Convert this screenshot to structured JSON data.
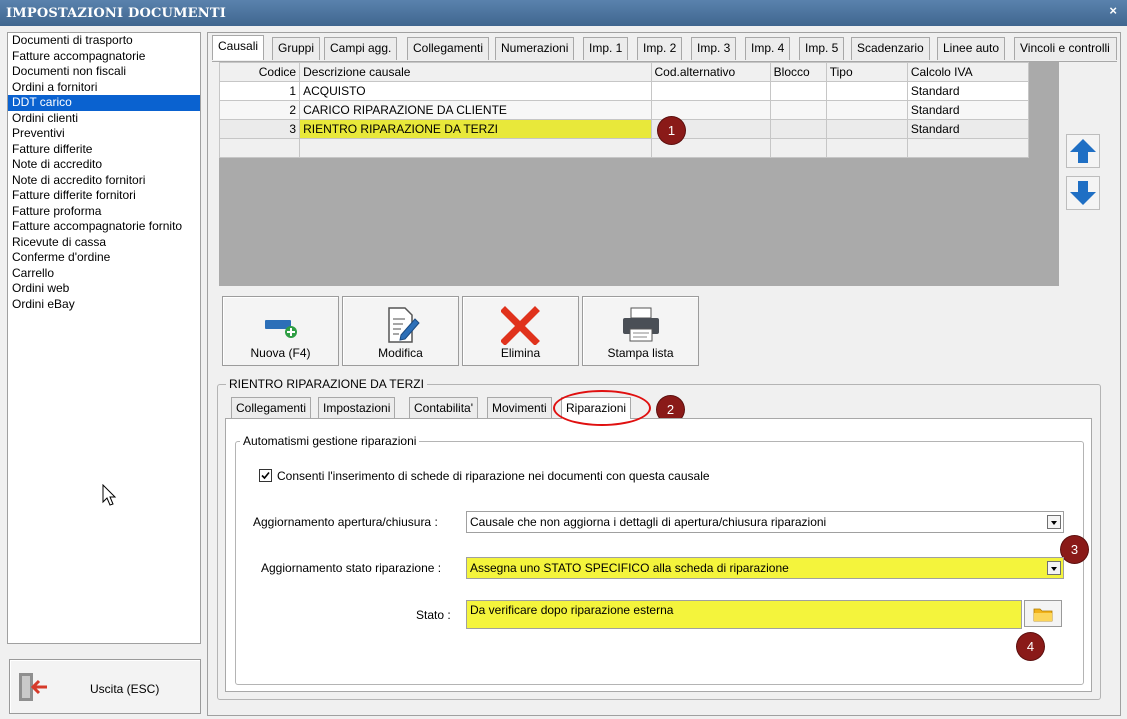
{
  "window": {
    "title": "IMPOSTAZIONI DOCUMENTI",
    "close_label": "×"
  },
  "doc_types": [
    "Documenti di trasporto",
    "Fatture accompagnatorie",
    "Documenti non fiscali",
    "Ordini a fornitori",
    "DDT carico",
    "Ordini clienti",
    "Preventivi",
    "Fatture differite",
    "Note di accredito",
    "Note di accredito fornitori",
    "Fatture differite fornitori",
    "Fatture proforma",
    "Fatture accompagnatorie fornito",
    "Ricevute di cassa",
    "Conferme d'ordine",
    "Carrello",
    "Ordini web",
    "Ordini eBay"
  ],
  "selected_doc": "DDT carico",
  "exit_button": {
    "label": "Uscita (ESC)",
    "icon": "exit-door-icon"
  },
  "main_tabs": [
    "Causali",
    "Gruppi",
    "Campi agg.",
    "Collegamenti",
    "Numerazioni",
    "Imp. 1",
    "Imp. 2",
    "Imp. 3",
    "Imp. 4",
    "Imp. 5",
    "Scadenzario",
    "Linee auto",
    "Vincoli e controlli"
  ],
  "active_main_tab": "Causali",
  "grid": {
    "columns": [
      "Codice",
      "Descrizione causale",
      "Cod.alternativo",
      "Blocco",
      "Tipo",
      "Calcolo IVA"
    ],
    "rows": [
      {
        "codice": "1",
        "descrizione": "ACQUISTO",
        "cod_alt": "",
        "blocco": "",
        "tipo": "",
        "iva": "Standard"
      },
      {
        "codice": "2",
        "descrizione": "CARICO RIPARAZIONE DA CLIENTE",
        "cod_alt": "",
        "blocco": "",
        "tipo": "",
        "iva": "Standard"
      },
      {
        "codice": "3",
        "descrizione": "RIENTRO RIPARAZIONE DA TERZI",
        "cod_alt": "",
        "blocco": "",
        "tipo": "",
        "iva": "Standard"
      }
    ]
  },
  "toolbar": {
    "new_label": "Nuova (F4)",
    "edit_label": "Modifica",
    "delete_label": "Elimina",
    "print_label": "Stampa lista"
  },
  "detail": {
    "group_title": "RIENTRO RIPARAZIONE DA TERZI",
    "sub_tabs": [
      "Collegamenti",
      "Impostazioni",
      "Contabilita'",
      "Movimenti",
      "Riparazioni"
    ],
    "active_sub_tab": "Riparazioni",
    "automation_title": "Automatismi gestione riparazioni",
    "checkbox_label": "Consenti l'inserimento di schede di riparazione nei documenti con questa causale",
    "checkbox_checked": true,
    "apertura_label": "Aggiornamento apertura/chiusura :",
    "apertura_value": "Causale che non aggiorna i dettagli di apertura/chiusura riparazioni",
    "stato_rip_label": "Aggiornamento stato riparazione :",
    "stato_rip_value": "Assegna uno STATO SPECIFICO alla scheda di riparazione",
    "stato_label": "Stato :",
    "stato_value": "Da verificare dopo riparazione esterna"
  },
  "badges": [
    "1",
    "2",
    "3",
    "4"
  ],
  "colors": {
    "titlebar": "#4a72a0",
    "selection": "#0a62d0",
    "highlight": "#e8e83a",
    "badge": "#8a1a18",
    "annotation_ring": "#e01010"
  }
}
